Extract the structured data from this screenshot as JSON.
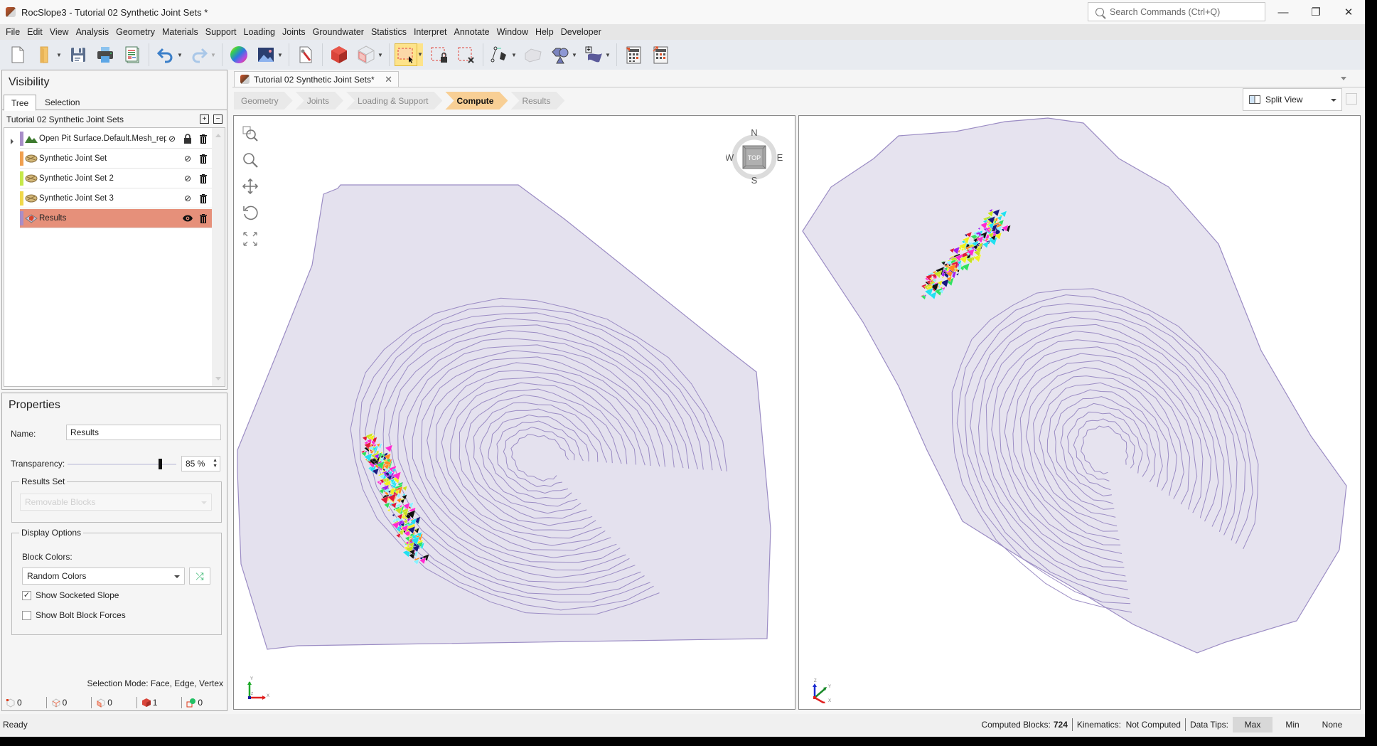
{
  "window": {
    "title": "RocSlope3 - Tutorial 02 Synthetic Joint Sets *",
    "search_placeholder": "Search Commands (Ctrl+Q)",
    "controls": {
      "minimize": "—",
      "restore": "❐",
      "close": "✕"
    }
  },
  "menu": [
    "File",
    "Edit",
    "View",
    "Analysis",
    "Geometry",
    "Materials",
    "Support",
    "Loading",
    "Joints",
    "Groundwater",
    "Statistics",
    "Interpret",
    "Annotate",
    "Window",
    "Help",
    "Developer"
  ],
  "toolbar": {
    "buttons": [
      "new-file",
      "open-folder",
      "save",
      "print",
      "report",
      "undo",
      "redo",
      "color-wheel",
      "image",
      "edit-geometry",
      "solid-block",
      "wireframe-block",
      "box-select",
      "lock-selection",
      "clear-selection",
      "pen-tool",
      "surface",
      "shapes",
      "import-surface",
      "calculator",
      "calculator-export"
    ]
  },
  "visibility": {
    "title": "Visibility",
    "tabs": [
      "Tree",
      "Selection"
    ],
    "active_tab": "Tree",
    "project_name": "Tutorial 02 Synthetic Joint Sets",
    "items": [
      {
        "label": "Open Pit Surface.Default.Mesh_rep",
        "color": "#a88ec8",
        "icon": "mountain-icon",
        "visible": false,
        "locked": true,
        "selected": false,
        "expandable": true
      },
      {
        "label": "Synthetic Joint Set",
        "color": "#f0a050",
        "icon": "joint-set-icon",
        "visible": false,
        "locked": false,
        "selected": false
      },
      {
        "label": "Synthetic Joint Set 2",
        "color": "#c6e84a",
        "icon": "joint-set-icon",
        "visible": false,
        "locked": false,
        "selected": false
      },
      {
        "label": "Synthetic Joint Set 3",
        "color": "#f0d84a",
        "icon": "joint-set-icon",
        "visible": false,
        "locked": false,
        "selected": false
      },
      {
        "label": "Results",
        "color": "#a88ec8",
        "icon": "results-icon",
        "visible": true,
        "locked": false,
        "selected": true
      }
    ]
  },
  "properties": {
    "title": "Properties",
    "name_label": "Name:",
    "name_value": "Results",
    "transparency_label": "Transparency:",
    "transparency_value": "85 %",
    "transparency_percent": 85,
    "results_set_label": "Results Set",
    "results_set_value": "Removable Blocks",
    "display_options_label": "Display Options",
    "block_colors_label": "Block Colors:",
    "block_colors_value": "Random Colors",
    "show_socketed_slope_label": "Show Socketed Slope",
    "show_socketed_slope": true,
    "show_bolt_forces_label": "Show Bolt Block Forces",
    "show_bolt_forces": false
  },
  "selection": {
    "mode_text": "Selection Mode: Face, Edge, Vertex",
    "counters": [
      {
        "name": "vertex",
        "value": "0"
      },
      {
        "name": "edge",
        "value": "0"
      },
      {
        "name": "face",
        "value": "0"
      },
      {
        "name": "block",
        "value": "1"
      },
      {
        "name": "support",
        "value": "0"
      }
    ]
  },
  "document": {
    "tab_title": "Tutorial 02 Synthetic Joint Sets*",
    "workflow": [
      "Geometry",
      "Joints",
      "Loading & Support",
      "Compute",
      "Results"
    ],
    "active_step": "Compute",
    "view_mode": "Split View"
  },
  "viewports": {
    "compass": {
      "n": "N",
      "s": "S",
      "e": "E",
      "w": "W",
      "face": "TOP"
    },
    "left_axes": {
      "x": "X",
      "y": "Y",
      "z": "Z"
    },
    "right_axes": {
      "x": "X",
      "y": "Y",
      "z": "Z"
    },
    "mesh_color": "#e4e1ee",
    "contour_color": "#9b8cc4"
  },
  "status": {
    "ready": "Ready",
    "computed_blocks_label": "Computed Blocks:",
    "computed_blocks_value": "724",
    "kinematics_label": "Kinematics:",
    "kinematics_value": "Not Computed",
    "data_tips_label": "Data Tips:",
    "data_tips_options": [
      "Max",
      "Min",
      "None"
    ],
    "data_tips_active": "Max"
  }
}
